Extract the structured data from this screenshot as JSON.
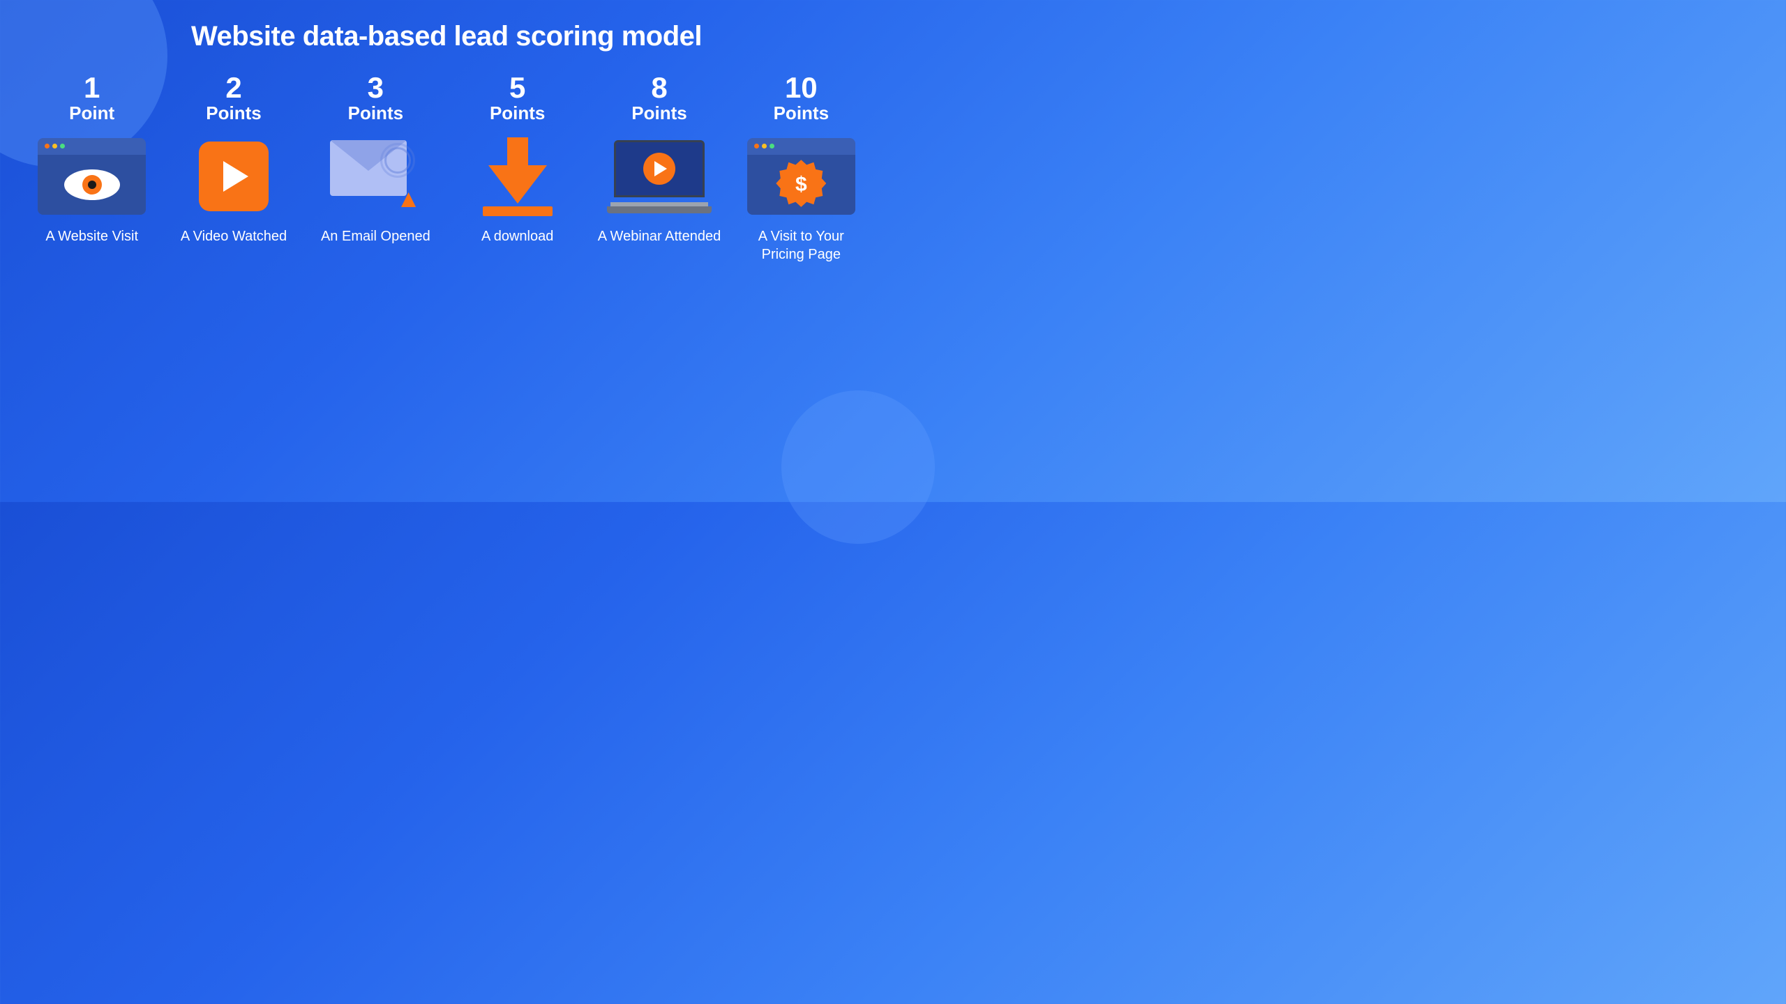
{
  "page": {
    "title": "Website data-based lead scoring model",
    "background": {
      "gradient_start": "#1a4fd6",
      "gradient_end": "#60a5fa"
    }
  },
  "items": [
    {
      "id": "website-visit",
      "points_number": "1",
      "points_word": "Point",
      "label": "A Website Visit",
      "icon": "browser-eye-icon"
    },
    {
      "id": "video-watched",
      "points_number": "2",
      "points_word": "Points",
      "label": "A Video Watched",
      "icon": "video-play-icon"
    },
    {
      "id": "email-opened",
      "points_number": "3",
      "points_word": "Points",
      "label": "An Email Opened",
      "icon": "email-cursor-icon"
    },
    {
      "id": "download",
      "points_number": "5",
      "points_word": "Points",
      "label": "A download",
      "icon": "download-arrow-icon"
    },
    {
      "id": "webinar-attended",
      "points_number": "8",
      "points_word": "Points",
      "label": "A Webinar Attended",
      "icon": "laptop-video-icon"
    },
    {
      "id": "pricing-page",
      "points_number": "10",
      "points_word": "Points",
      "label": "A Visit to Your Pricing Page",
      "icon": "browser-dollar-icon"
    }
  ]
}
